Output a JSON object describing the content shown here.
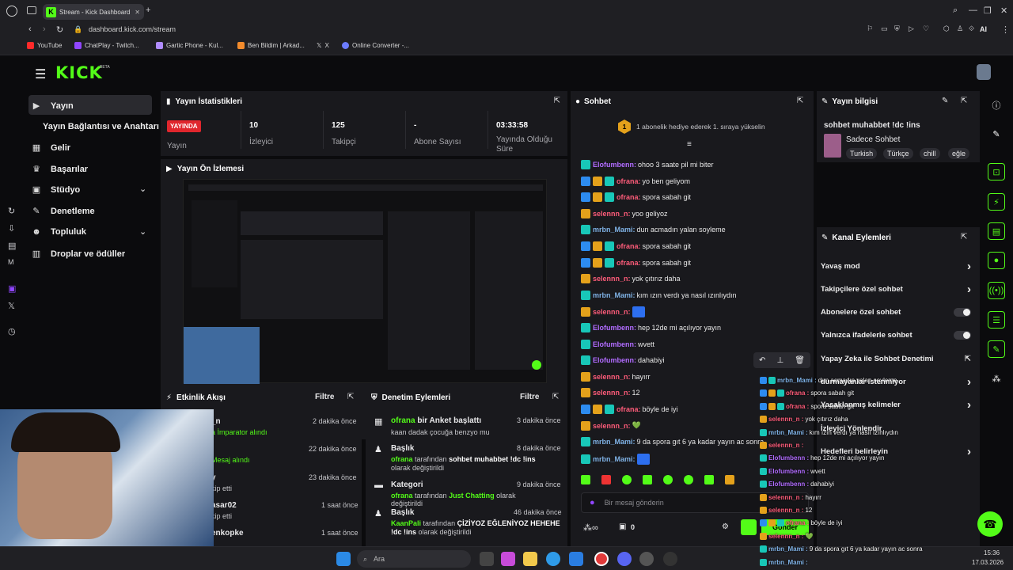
{
  "browser": {
    "tab_title": "Stream - Kick Dashboard",
    "url": "dashboard.kick.com/stream",
    "ai_label": "AI",
    "bookmarks": [
      "YouTube",
      "ChatPlay - Twitch...",
      "Gartic Phone - Kul...",
      "Ben Bildim | Arkad...",
      "X",
      "Online Converter -..."
    ]
  },
  "brand": {
    "logo": "KICK",
    "beta": "BETA"
  },
  "sidebar": {
    "items": [
      {
        "label": "Yayın",
        "icon": "video-icon"
      },
      {
        "label": "Yayın Bağlantısı ve Anahtarı"
      },
      {
        "label": "Gelir",
        "icon": "chart-icon"
      },
      {
        "label": "Başarılar",
        "icon": "trophy-icon"
      },
      {
        "label": "Stüdyo",
        "icon": "studio-icon"
      },
      {
        "label": "Denetleme",
        "icon": "wrench-icon"
      },
      {
        "label": "Topluluk",
        "icon": "people-icon"
      },
      {
        "label": "Droplar ve ödüller",
        "icon": "gift-icon"
      }
    ]
  },
  "stats": {
    "title": "Yayın İstatistikleri",
    "live_badge": "YAYINDA",
    "items": [
      {
        "value": "",
        "label": "Yayın"
      },
      {
        "value": "10",
        "label": "İzleyici"
      },
      {
        "value": "125",
        "label": "Takipçi"
      },
      {
        "value": "-",
        "label": "Abone Sayısı"
      },
      {
        "value": "03:33:58",
        "label": "Yayında Olduğu Süre"
      }
    ]
  },
  "preview": {
    "title": "Yayın Ön İzlemesi"
  },
  "activity": {
    "title": "Etkinlik Akışı",
    "filter": "Filtre",
    "items": [
      {
        "name": "_n",
        "detail": "a İmparator alındı",
        "time": "2 dakika önce"
      },
      {
        "name": "",
        "detail": "Mesaj alındı",
        "time": "22 dakika önce"
      },
      {
        "name": "y",
        "detail": "kip etti",
        "time": "23 dakika önce"
      },
      {
        "name": "asar02",
        "detail": "kip etti",
        "time": "1 saat önce"
      },
      {
        "name": "enkopke",
        "detail": "",
        "time": "1 saat önce"
      }
    ]
  },
  "moderation": {
    "title": "Denetim Eylemleri",
    "filter": "Filtre",
    "items": [
      {
        "title_user": "ofrana",
        "title_rest": "bir Anket başlattı",
        "sub": "kaan dadak çocuğa benzyo mu",
        "time": "3 dakika önce"
      },
      {
        "title_user": "",
        "title_rest": "Başlık",
        "sub_user": "ofrana",
        "sub_mid": "tarafından",
        "sub_value": "sohbet muhabbet !dc !ins",
        "sub_end": "olarak değiştirildi",
        "time": "8 dakika önce"
      },
      {
        "title_user": "",
        "title_rest": "Kategori",
        "sub_user": "ofrana",
        "sub_mid": "tarafından",
        "sub_value": "Just Chatting",
        "sub_end": "olarak değiştirildi",
        "time": "9 dakika önce"
      },
      {
        "title_user": "",
        "title_rest": "Başlık",
        "sub_user": "KaanPali",
        "sub_mid": "tarafından",
        "sub_value": "ÇİZİYOZ EĞLENİYOZ HEHEHE !dc !ins",
        "sub_end": "olarak değiştirildi",
        "time": "46 dakika önce"
      }
    ]
  },
  "chat": {
    "title": "Sohbet",
    "promo_count": "1",
    "promo_text": "1 abonelik hediye ederek 1. sıraya yükselin",
    "messages": [
      {
        "badges": [
          "teal"
        ],
        "user": "Elofumbenn",
        "color": "#b16cff",
        "text": "ohoo 3 saate pil mi biter"
      },
      {
        "badges": [
          "blue",
          "gold",
          "teal"
        ],
        "user": "ofrana",
        "color": "#ff5c7a",
        "text": "yo ben geliyom"
      },
      {
        "badges": [
          "blue",
          "gold",
          "teal"
        ],
        "user": "ofrana",
        "color": "#ff5c7a",
        "text": "spora sabah git"
      },
      {
        "badges": [
          "gold"
        ],
        "user": "selennn_n",
        "color": "#ff5c7a",
        "text": "yoo geliyoz"
      },
      {
        "badges": [
          "teal"
        ],
        "user": "mrbn_Mami",
        "color": "#7fb2e6",
        "text": "dun acmadın yalan soyleme"
      },
      {
        "badges": [
          "blue",
          "gold",
          "teal"
        ],
        "user": "ofrana",
        "color": "#ff5c7a",
        "text": "spora sabah git"
      },
      {
        "badges": [
          "blue",
          "gold",
          "teal"
        ],
        "user": "ofrana",
        "color": "#ff5c7a",
        "text": "spora sabah git"
      },
      {
        "badges": [
          "gold"
        ],
        "user": "selennn_n",
        "color": "#ff5c7a",
        "text": "yok çıtırız daha"
      },
      {
        "badges": [
          "teal"
        ],
        "user": "mrbn_Mami",
        "color": "#7fb2e6",
        "text": "kım ızın verdı ya nasıl ızınlıydın"
      },
      {
        "badges": [
          "gold"
        ],
        "user": "selennn_n",
        "color": "#ff5c7a",
        "text": ""
      },
      {
        "badges": [
          "teal"
        ],
        "user": "Elofumbenn",
        "color": "#b16cff",
        "text": "hep 12de mi açılıyor yayın"
      },
      {
        "badges": [
          "teal"
        ],
        "user": "Elofumbenn",
        "color": "#b16cff",
        "text": "wvett"
      },
      {
        "badges": [
          "teal"
        ],
        "user": "Elofumbenn",
        "color": "#b16cff",
        "text": "dahabiyi"
      },
      {
        "badges": [
          "gold"
        ],
        "user": "selennn_n",
        "color": "#ff5c7a",
        "text": "hayırr"
      },
      {
        "badges": [
          "gold"
        ],
        "user": "selennn_n",
        "color": "#ff5c7a",
        "text": "12"
      },
      {
        "badges": [
          "blue",
          "gold",
          "teal"
        ],
        "user": "ofrana",
        "color": "#ff5c7a",
        "text": "böyle de iyi"
      },
      {
        "badges": [
          "gold"
        ],
        "user": "selennn_n",
        "color": "#ff5c7a",
        "text": "💚"
      },
      {
        "badges": [
          "teal"
        ],
        "user": "mrbn_Mami",
        "color": "#7fb2e6",
        "text": "9 da spora gıt 6 ya kadar yayın ac sonra"
      },
      {
        "badges": [
          "teal"
        ],
        "user": "mrbn_Mami",
        "color": "#7fb2e6",
        "text": ""
      }
    ],
    "input_placeholder": "Bir mesaj gönderin",
    "send_label": "Gönder",
    "count": "0"
  },
  "overlay_chat": [
    {
      "badges": [
        "blue",
        "teal"
      ],
      "user": "mrbn_Mami",
      "color": "#7fb2e6",
      "text": "dun acmadın yalan soyleme"
    },
    {
      "badges": [
        "blue",
        "gold",
        "teal"
      ],
      "user": "ofrana",
      "color": "#ff5c7a",
      "text": "spora sabah git"
    },
    {
      "badges": [
        "blue",
        "gold",
        "teal"
      ],
      "user": "ofrana",
      "color": "#ff5c7a",
      "text": "spora sabah git"
    },
    {
      "badges": [
        "gold"
      ],
      "user": "selennn_n",
      "color": "#ff5c7a",
      "text": "yok çıtırız daha"
    },
    {
      "badges": [
        "teal"
      ],
      "user": "mrbn_Mami",
      "color": "#7fb2e6",
      "text": "kım ızın verdı ya nasıl ızınlıydın"
    },
    {
      "badges": [
        "gold"
      ],
      "user": "selennn_n",
      "color": "#ff5c7a",
      "text": ""
    },
    {
      "badges": [
        "teal"
      ],
      "user": "Elofumbenn",
      "color": "#b16cff",
      "text": "hep 12de mi açılıyor yayın"
    },
    {
      "badges": [
        "teal"
      ],
      "user": "Elofumbenn",
      "color": "#b16cff",
      "text": "wvett"
    },
    {
      "badges": [
        "teal"
      ],
      "user": "Elofumbenn",
      "color": "#b16cff",
      "text": "dahabiyi"
    },
    {
      "badges": [
        "gold"
      ],
      "user": "selennn_n",
      "color": "#ff5c7a",
      "text": "hayırr"
    },
    {
      "badges": [
        "gold"
      ],
      "user": "selennn_n",
      "color": "#ff5c7a",
      "text": "12"
    },
    {
      "badges": [
        "blue",
        "gold",
        "teal"
      ],
      "user": "ofrana",
      "color": "#ff5c7a",
      "text": "böyle de iyi"
    },
    {
      "badges": [
        "gold"
      ],
      "user": "selennn_n",
      "color": "#ff5c7a",
      "text": "💚"
    },
    {
      "badges": [
        "teal"
      ],
      "user": "mrbn_Mami",
      "color": "#7fb2e6",
      "text": "9 da spora gıt 6 ya kadar yayın ac sonra"
    },
    {
      "badges": [
        "teal"
      ],
      "user": "mrbn_Mami",
      "color": "#7fb2e6",
      "text": ""
    }
  ],
  "stream_info": {
    "title": "Yayın bilgisi",
    "stream_title": "sohbet muhabbet !dc !ins",
    "category": "Sadece Sohbet",
    "tags": [
      "Turkish",
      "Türkçe",
      "chill",
      "eğle"
    ]
  },
  "channel_actions": {
    "title": "Kanal Eylemleri",
    "items": [
      {
        "label": "Yavaş mod",
        "type": "chevron"
      },
      {
        "label": "Takipçilere özel sohbet",
        "type": "chevron"
      },
      {
        "label": "Abonelere özel sohbet",
        "type": "toggle"
      },
      {
        "label": "Yalnızca ifadelerle sohbet",
        "type": "toggle"
      },
      {
        "label": "Yapay Zeka ile Sohbet Denetimi",
        "type": "external"
      },
      {
        "label": "durmayanlar istenmiyor",
        "type": "chevron"
      },
      {
        "label": "Yasaklanmış kelimeler",
        "type": "chevron"
      },
      {
        "label": "İzleyici Yönlendir",
        "type": "none"
      },
      {
        "label": "Hedefleri belirleyin",
        "type": "chevron"
      }
    ]
  },
  "taskbar": {
    "search_placeholder": "Ara",
    "time": "15:36",
    "date": "17.03.2026"
  },
  "colors": {
    "accent": "#53fc18",
    "live": "#e0262d",
    "panel": "#19191d",
    "bg": "#0b0b0d"
  }
}
